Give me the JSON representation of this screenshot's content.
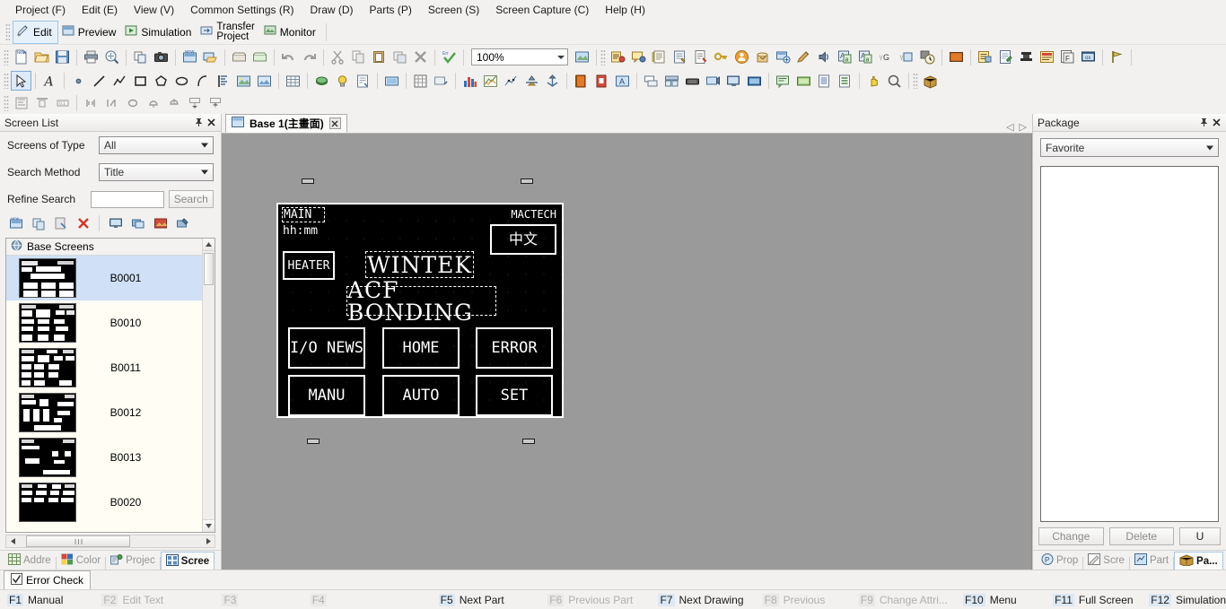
{
  "menu": {
    "items": [
      {
        "label": "Project (F)",
        "name": "menu-project"
      },
      {
        "label": "Edit (E)",
        "name": "menu-edit"
      },
      {
        "label": "View (V)",
        "name": "menu-view"
      },
      {
        "label": "Common Settings (R)",
        "name": "menu-common-settings"
      },
      {
        "label": "Draw (D)",
        "name": "menu-draw"
      },
      {
        "label": "Parts (P)",
        "name": "menu-parts"
      },
      {
        "label": "Screen (S)",
        "name": "menu-screen"
      },
      {
        "label": "Screen Capture (C)",
        "name": "menu-screen-capture"
      },
      {
        "label": "Help (H)",
        "name": "menu-help"
      }
    ]
  },
  "modebar": {
    "edit": "Edit",
    "preview": "Preview",
    "simulation": "Simulation",
    "transfer_line1": "Transfer",
    "transfer_line2": "Project",
    "monitor": "Monitor"
  },
  "toolbar": {
    "zoom_value": "100%"
  },
  "screen_list": {
    "title": "Screen List",
    "pin_icon": "pin-icon",
    "close_icon": "close-icon",
    "type_label": "Screens of Type",
    "type_value": "All",
    "method_label": "Search Method",
    "method_value": "Title",
    "refine_label": "Refine Search",
    "refine_value": "",
    "refine_placeholder": "",
    "search_button": "Search",
    "group_label": "Base Screens",
    "rows": [
      {
        "name": "B0001",
        "selected": true
      },
      {
        "name": "B0010",
        "selected": false
      },
      {
        "name": "B0011",
        "selected": false
      },
      {
        "name": "B0012",
        "selected": false
      },
      {
        "name": "B0013",
        "selected": false
      },
      {
        "name": "B0020",
        "selected": false
      }
    ],
    "tabs": [
      {
        "label": "Addre",
        "name": "panel-tab-address",
        "active": false
      },
      {
        "label": "Color",
        "name": "panel-tab-color",
        "active": false
      },
      {
        "label": "Projec",
        "name": "panel-tab-project",
        "active": false
      },
      {
        "label": "Scree",
        "name": "panel-tab-screen",
        "active": true
      }
    ]
  },
  "document": {
    "tab_label": "Base 1(主畫面)",
    "tab_icon": "screen-icon",
    "close_icon": "close-icon",
    "nav_prev": "◁",
    "nav_next": "▷"
  },
  "hmi": {
    "title": "MAIN",
    "clock": "hh:mm",
    "brand": "MACTECH",
    "lang_button": "中文",
    "heater_button": "HEATER",
    "line1": "WINTEK",
    "line2": "ACF BONDING",
    "buttons": [
      {
        "label": "I/O NEWS",
        "name": "hmi-button-io-news"
      },
      {
        "label": "HOME",
        "name": "hmi-button-home"
      },
      {
        "label": "ERROR",
        "name": "hmi-button-error"
      },
      {
        "label": "MANU",
        "name": "hmi-button-manu"
      },
      {
        "label": "AUTO",
        "name": "hmi-button-auto"
      },
      {
        "label": "SET",
        "name": "hmi-button-set"
      }
    ]
  },
  "package": {
    "title": "Package",
    "pin_icon": "pin-icon",
    "close_icon": "close-icon",
    "category_value": "Favorite",
    "change_button": "Change",
    "delete_button": "Delete",
    "update_button": "U",
    "tabs": [
      {
        "label": "Prop",
        "name": "package-tab-property",
        "active": false
      },
      {
        "label": "Scre",
        "name": "package-tab-screen",
        "active": false
      },
      {
        "label": "Part",
        "name": "package-tab-part",
        "active": false
      },
      {
        "label": "Pa...",
        "name": "package-tab-package",
        "active": true
      }
    ]
  },
  "bottom": {
    "error_check_tab": "Error Check",
    "fkeys": [
      {
        "key": "F1",
        "label": "Manual",
        "enabled": true
      },
      {
        "key": "F2",
        "label": "Edit Text",
        "enabled": false
      },
      {
        "key": "F3",
        "label": "",
        "enabled": false
      },
      {
        "key": "F4",
        "label": "",
        "enabled": false
      },
      {
        "key": "F5",
        "label": "Next Part",
        "enabled": true
      },
      {
        "key": "F6",
        "label": "Previous Part",
        "enabled": false
      },
      {
        "key": "F7",
        "label": "Next Drawing",
        "enabled": true
      },
      {
        "key": "F8",
        "label": "Previous",
        "enabled": false
      },
      {
        "key": "F9",
        "label": "Change Attri...",
        "enabled": false
      },
      {
        "key": "F10",
        "label": "Menu",
        "enabled": true
      },
      {
        "key": "F11",
        "label": "Full Screen",
        "enabled": true
      },
      {
        "key": "F12",
        "label": "Simulation",
        "enabled": true
      }
    ]
  },
  "colors": {
    "accent": "#cfe0f7",
    "canvas_bg": "#9a9a9a",
    "hmi_bg": "#000000",
    "hmi_fg": "#ffffff",
    "panel_bg": "#f2f1f0"
  }
}
